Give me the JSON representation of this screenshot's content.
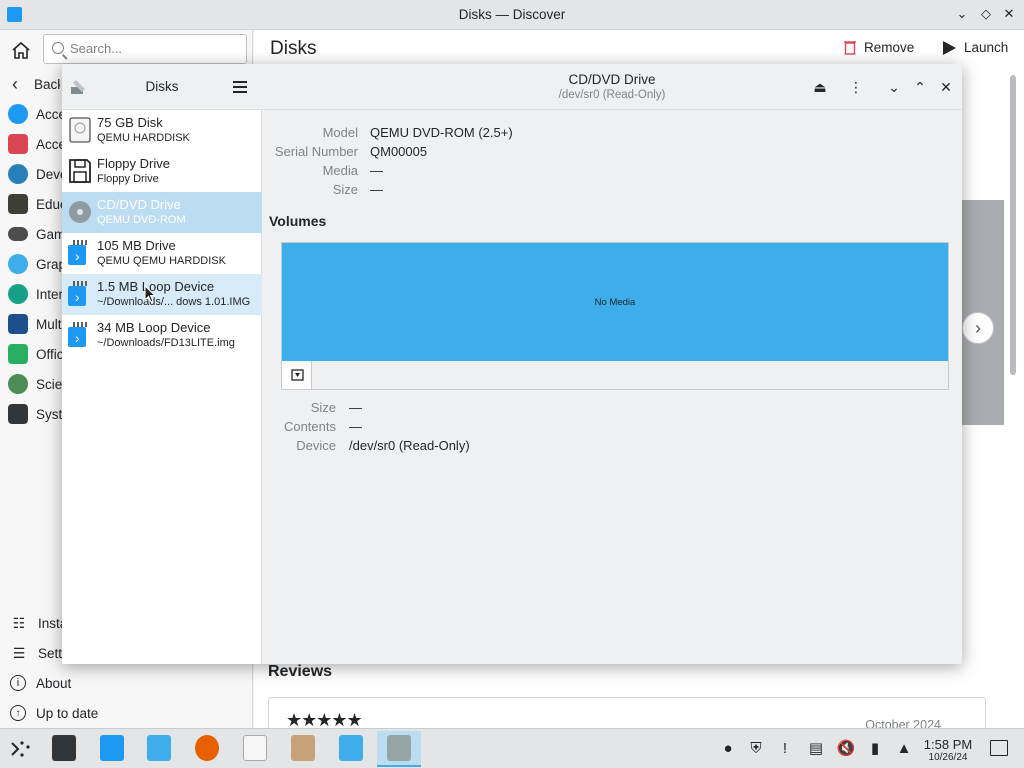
{
  "window_title": "Disks — Discover",
  "discover": {
    "search_placeholder": "Search...",
    "page_heading": "Disks",
    "remove_label": "Remove",
    "launch_label": "Launch",
    "back_label": "Back",
    "categories": [
      "Accessibility",
      "Accessories",
      "Developer Tools",
      "Education",
      "Games",
      "Graphics",
      "Internet",
      "Multimedia",
      "Office",
      "Science",
      "System"
    ],
    "bottom_items": [
      "Installed",
      "Settings",
      "About",
      "Up to date"
    ],
    "reviews_heading": "Reviews",
    "review_stars": "★★★★★",
    "review_date": "October 2024"
  },
  "disks": {
    "sidebar_title": "Disks",
    "header_title": "CD/DVD Drive",
    "header_subtitle": "/dev/sr0 (Read-Only)",
    "drives": [
      {
        "name": "75 GB Disk",
        "sub": "QEMU HARDDISK"
      },
      {
        "name": "Floppy Drive",
        "sub": "Floppy Drive"
      },
      {
        "name": "CD/DVD Drive",
        "sub": "QEMU DVD-ROM"
      },
      {
        "name": "105 MB Drive",
        "sub": "QEMU QEMU HARDDISK"
      },
      {
        "name": "1.5 MB Loop Device",
        "sub": "~/Downloads/... dows 1.01.IMG"
      },
      {
        "name": "34 MB Loop Device",
        "sub": "~/Downloads/FD13LITE.img"
      }
    ],
    "properties": {
      "model_label": "Model",
      "model_value": "QEMU DVD-ROM (2.5+)",
      "serial_label": "Serial Number",
      "serial_value": "QM00005",
      "media_label": "Media",
      "media_value": "—",
      "size_label": "Size",
      "size_value": "—"
    },
    "volumes_heading": "Volumes",
    "volume_text": "No Media",
    "volume_props": {
      "size_label": "Size",
      "size_value": "—",
      "contents_label": "Contents",
      "contents_value": "—",
      "device_label": "Device",
      "device_value": "/dev/sr0 (Read-Only)"
    }
  },
  "taskbar": {
    "time": "1:58 PM",
    "date": "10/26/24"
  }
}
